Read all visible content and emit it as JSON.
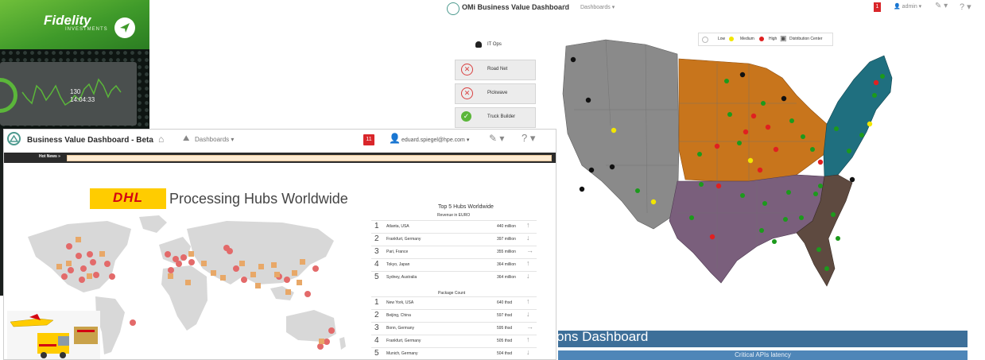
{
  "fidelity": {
    "logo": "Fidelity",
    "logo_sub": "INVESTMENTS",
    "readout_value": "130",
    "readout_time": "14:04:33"
  },
  "omi": {
    "title": "OMi Business Value Dashboard",
    "nav_dashboards": "Dashboards ▾",
    "badge": "1",
    "user": "admin ▾",
    "tools_icon": "wrench-icon",
    "help": "? ▾",
    "status_group": "IT Ops",
    "cards": [
      {
        "label": "Road Net",
        "status": "error"
      },
      {
        "label": "Pickwave",
        "status": "error"
      },
      {
        "label": "Truck Builder",
        "status": "ok"
      }
    ],
    "legend": [
      {
        "label": "Low",
        "color": "#ffffff"
      },
      {
        "label": "Medium",
        "color": "#f2e600"
      },
      {
        "label": "High",
        "color": "#e02020"
      },
      {
        "label": "Distribution Center",
        "color": "#222222"
      }
    ],
    "region_colors": {
      "west": "#8a8a8a",
      "midwest": "#c8751c",
      "northeast": "#1f6f7f",
      "south": "#7a5f7c",
      "southeast": "#5e4a40"
    }
  },
  "ops": {
    "title": "ons Dashboard",
    "subtitle": "Critical APIs latency"
  },
  "dhl": {
    "title": "Business Value Dashboard - Beta",
    "nav_dashboards": "Dashboards ▾",
    "badge": "11",
    "user": "eduard.spiegel@hpe.com ▾",
    "help": "? ▾",
    "hot_news_label": "Hot News »",
    "brand": "DHL",
    "heading": "Processing Hubs Worldwide",
    "table_title": "Top 5 Hubs Worldwide",
    "revenue_subtitle": "Revenue in EURO",
    "package_subtitle": "Package Count",
    "revenue_rows": [
      {
        "rank": "1",
        "name": "Atlanta, USA",
        "value": "440 million",
        "trend": "↑"
      },
      {
        "rank": "2",
        "name": "Frankfurt, Germany",
        "value": "397 million",
        "trend": "↓"
      },
      {
        "rank": "3",
        "name": "Pari, France",
        "value": "355 million",
        "trend": "→"
      },
      {
        "rank": "4",
        "name": "Tokyo, Japan",
        "value": "364 million",
        "trend": "↑"
      },
      {
        "rank": "5",
        "name": "Sydney, Australia",
        "value": "364 million",
        "trend": "↓"
      }
    ],
    "package_rows": [
      {
        "rank": "1",
        "name": "New York, USA",
        "value": "640 thsd",
        "trend": "↑"
      },
      {
        "rank": "2",
        "name": "Beijing, China",
        "value": "597 thsd",
        "trend": "↓"
      },
      {
        "rank": "3",
        "name": "Bonn, Germany",
        "value": "595 thsd",
        "trend": "→"
      },
      {
        "rank": "4",
        "name": "Frankfurt, Germany",
        "value": "505 thsd",
        "trend": "↑"
      },
      {
        "rank": "5",
        "name": "Munich, Germany",
        "value": "504 thsd",
        "trend": "↓"
      }
    ]
  }
}
